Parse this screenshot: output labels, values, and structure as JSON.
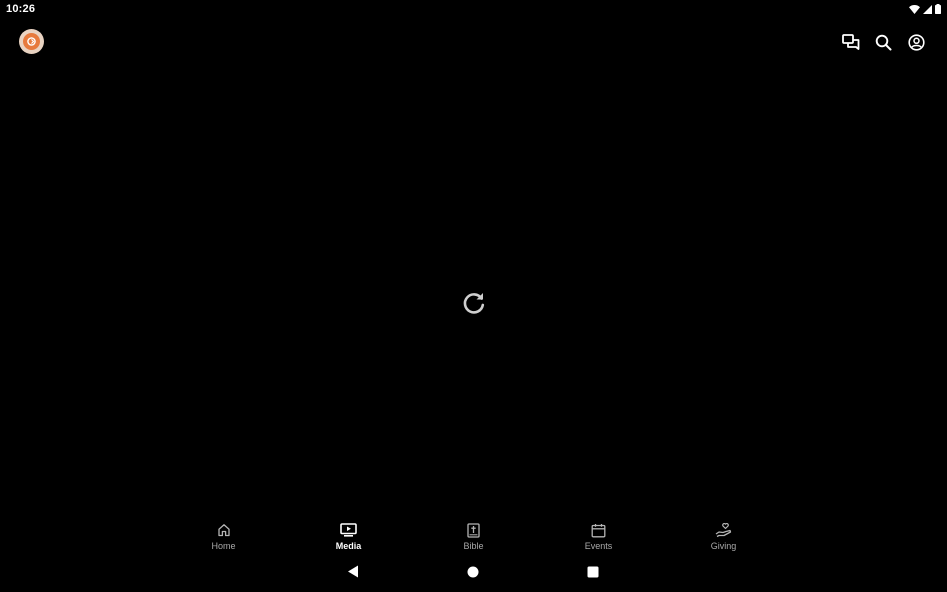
{
  "status_bar": {
    "time": "10:26"
  },
  "app_bar": {
    "logo": "church-logo",
    "actions": [
      "chat-icon",
      "search-icon",
      "account-icon"
    ]
  },
  "content": {
    "reload_icon": "reload-icon"
  },
  "bottom_nav": {
    "items": [
      {
        "label": "Home",
        "icon": "home-icon",
        "active": false
      },
      {
        "label": "Media",
        "icon": "media-icon",
        "active": true
      },
      {
        "label": "Bible",
        "icon": "bible-icon",
        "active": false
      },
      {
        "label": "Events",
        "icon": "calendar-icon",
        "active": false
      },
      {
        "label": "Giving",
        "icon": "giving-icon",
        "active": false
      }
    ]
  },
  "colors": {
    "background": "#000000",
    "accent": "#e77a3d",
    "inactive_label": "#a8a8a8",
    "active_label": "#ffffff"
  }
}
